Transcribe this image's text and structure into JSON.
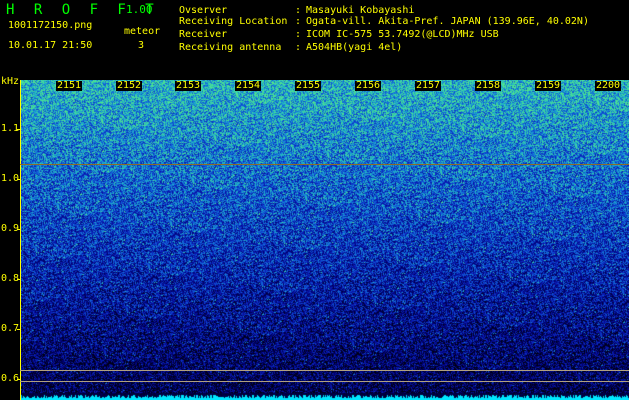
{
  "header": {
    "app_title": "H R O F F T",
    "app_version": "1.00",
    "filename": "1001172150.png",
    "datetime": "10.01.17 21:50",
    "meteor_label": "meteor",
    "meteor_count": "3",
    "info": [
      {
        "label": "Ovserver",
        "value": "Masayuki Kobayashi"
      },
      {
        "label": "Receiving Location",
        "value": "Ogata-vill. Akita-Pref. JAPAN (139.96E, 40.02N)"
      },
      {
        "label": "Receiver",
        "value": "ICOM IC-575 53.7492(@LCD)MHz USB"
      },
      {
        "label": "Receiving antenna",
        "value": "A504HB(yagi 4el)"
      }
    ]
  },
  "chart_data": {
    "type": "heatmap",
    "title": "",
    "xlabel": "",
    "ylabel": "kHz",
    "x_tick_labels": [
      "2151",
      "2152",
      "2153",
      "2154",
      "2155",
      "2156",
      "2157",
      "2158",
      "2159",
      "2200"
    ],
    "y_tick_labels": [
      "1.1",
      "1.0",
      "0.9",
      "0.8",
      "0.7",
      "0.6"
    ],
    "y_ticks": [
      1.1,
      1.0,
      0.9,
      0.8,
      0.7,
      0.6
    ],
    "ylim": [
      0.58,
      1.18
    ],
    "reference_lines_khz": [
      1.025,
      0.615,
      0.595
    ],
    "meteor_count": 3,
    "colormap": [
      "#000010",
      "#00006e",
      "#0a1ab4",
      "#1060dc",
      "#20b4c8",
      "#50e68c"
    ]
  },
  "colors": {
    "background": "#000000",
    "text": "#ffff00",
    "title": "#00ff00",
    "ref_line_upper": "#8a6a2a",
    "ref_line_lower": "#b0a080",
    "baseline": "#00e6ff"
  }
}
